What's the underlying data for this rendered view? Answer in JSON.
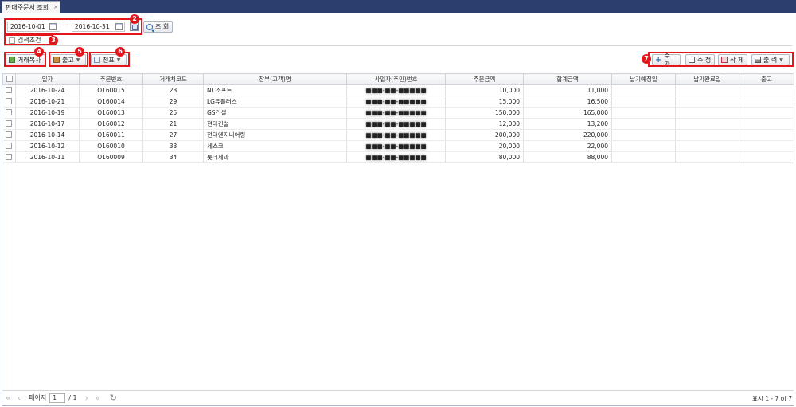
{
  "tab": {
    "title": "판매주문서 조회",
    "close": "×"
  },
  "search": {
    "date_from": "2016-10-01",
    "tilde": "~",
    "date_to": "2016-10-31",
    "search_label": "조 회",
    "condition_label": "검색조건"
  },
  "toolbar": {
    "copy_label": "거래복사",
    "release_label": "출고",
    "slip_label": "전표",
    "add_label": "추 가",
    "edit_label": "수 정",
    "delete_label": "삭 제",
    "print_label": "출 력"
  },
  "callouts": [
    "2",
    "3",
    "4",
    "5",
    "6",
    "7"
  ],
  "table": {
    "headers": [
      "일자",
      "주문번호",
      "거래처코드",
      "장부(고객)명",
      "사업자(주민)번호",
      "주문금액",
      "합계금액",
      "납기예정일",
      "납기완료일",
      "출고"
    ],
    "rows": [
      [
        "2016-10-24",
        "O160015",
        "23",
        "NC소프트",
        "■■■-■■-■■■■■",
        "10,000",
        "11,000",
        "",
        "",
        ""
      ],
      [
        "2016-10-21",
        "O160014",
        "29",
        "LG유플러스",
        "■■■-■■-■■■■■",
        "15,000",
        "16,500",
        "",
        "",
        ""
      ],
      [
        "2016-10-19",
        "O160013",
        "25",
        "GS건설",
        "■■■-■■-■■■■■",
        "150,000",
        "165,000",
        "",
        "",
        ""
      ],
      [
        "2016-10-17",
        "O160012",
        "21",
        "현대건설",
        "■■■-■■-■■■■■",
        "12,000",
        "13,200",
        "",
        "",
        ""
      ],
      [
        "2016-10-14",
        "O160011",
        "27",
        "현대엔지니어링",
        "■■■-■■-■■■■■",
        "200,000",
        "220,000",
        "",
        "",
        ""
      ],
      [
        "2016-10-12",
        "O160010",
        "33",
        "세스코",
        "■■■-■■-■■■■■",
        "20,000",
        "22,000",
        "",
        "",
        ""
      ],
      [
        "2016-10-11",
        "O160009",
        "34",
        "롯데제과",
        "■■■-■■-■■■■■",
        "80,000",
        "88,000",
        "",
        "",
        ""
      ]
    ]
  },
  "pager": {
    "page_label": "페이지",
    "page_value": "1",
    "total_pages": "/ 1",
    "status": "표시 1 - 7 of 7"
  },
  "colors": {
    "accent_red": "#e4151b",
    "tabbar": "#2b3e6e"
  }
}
